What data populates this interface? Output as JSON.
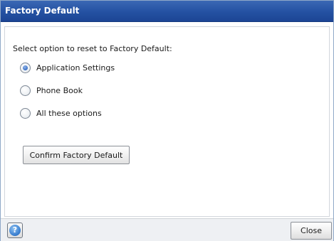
{
  "dialog": {
    "title": "Factory Default"
  },
  "main": {
    "prompt": "Select option to reset to Factory Default:",
    "options": [
      {
        "label": "Application Settings",
        "checked": true
      },
      {
        "label": "Phone Book",
        "checked": false
      },
      {
        "label": "All these options",
        "checked": false
      }
    ],
    "confirm_label": "Confirm Factory Default"
  },
  "footer": {
    "help_icon": "help-icon",
    "help_glyph": "?",
    "close_label": "Close"
  }
}
